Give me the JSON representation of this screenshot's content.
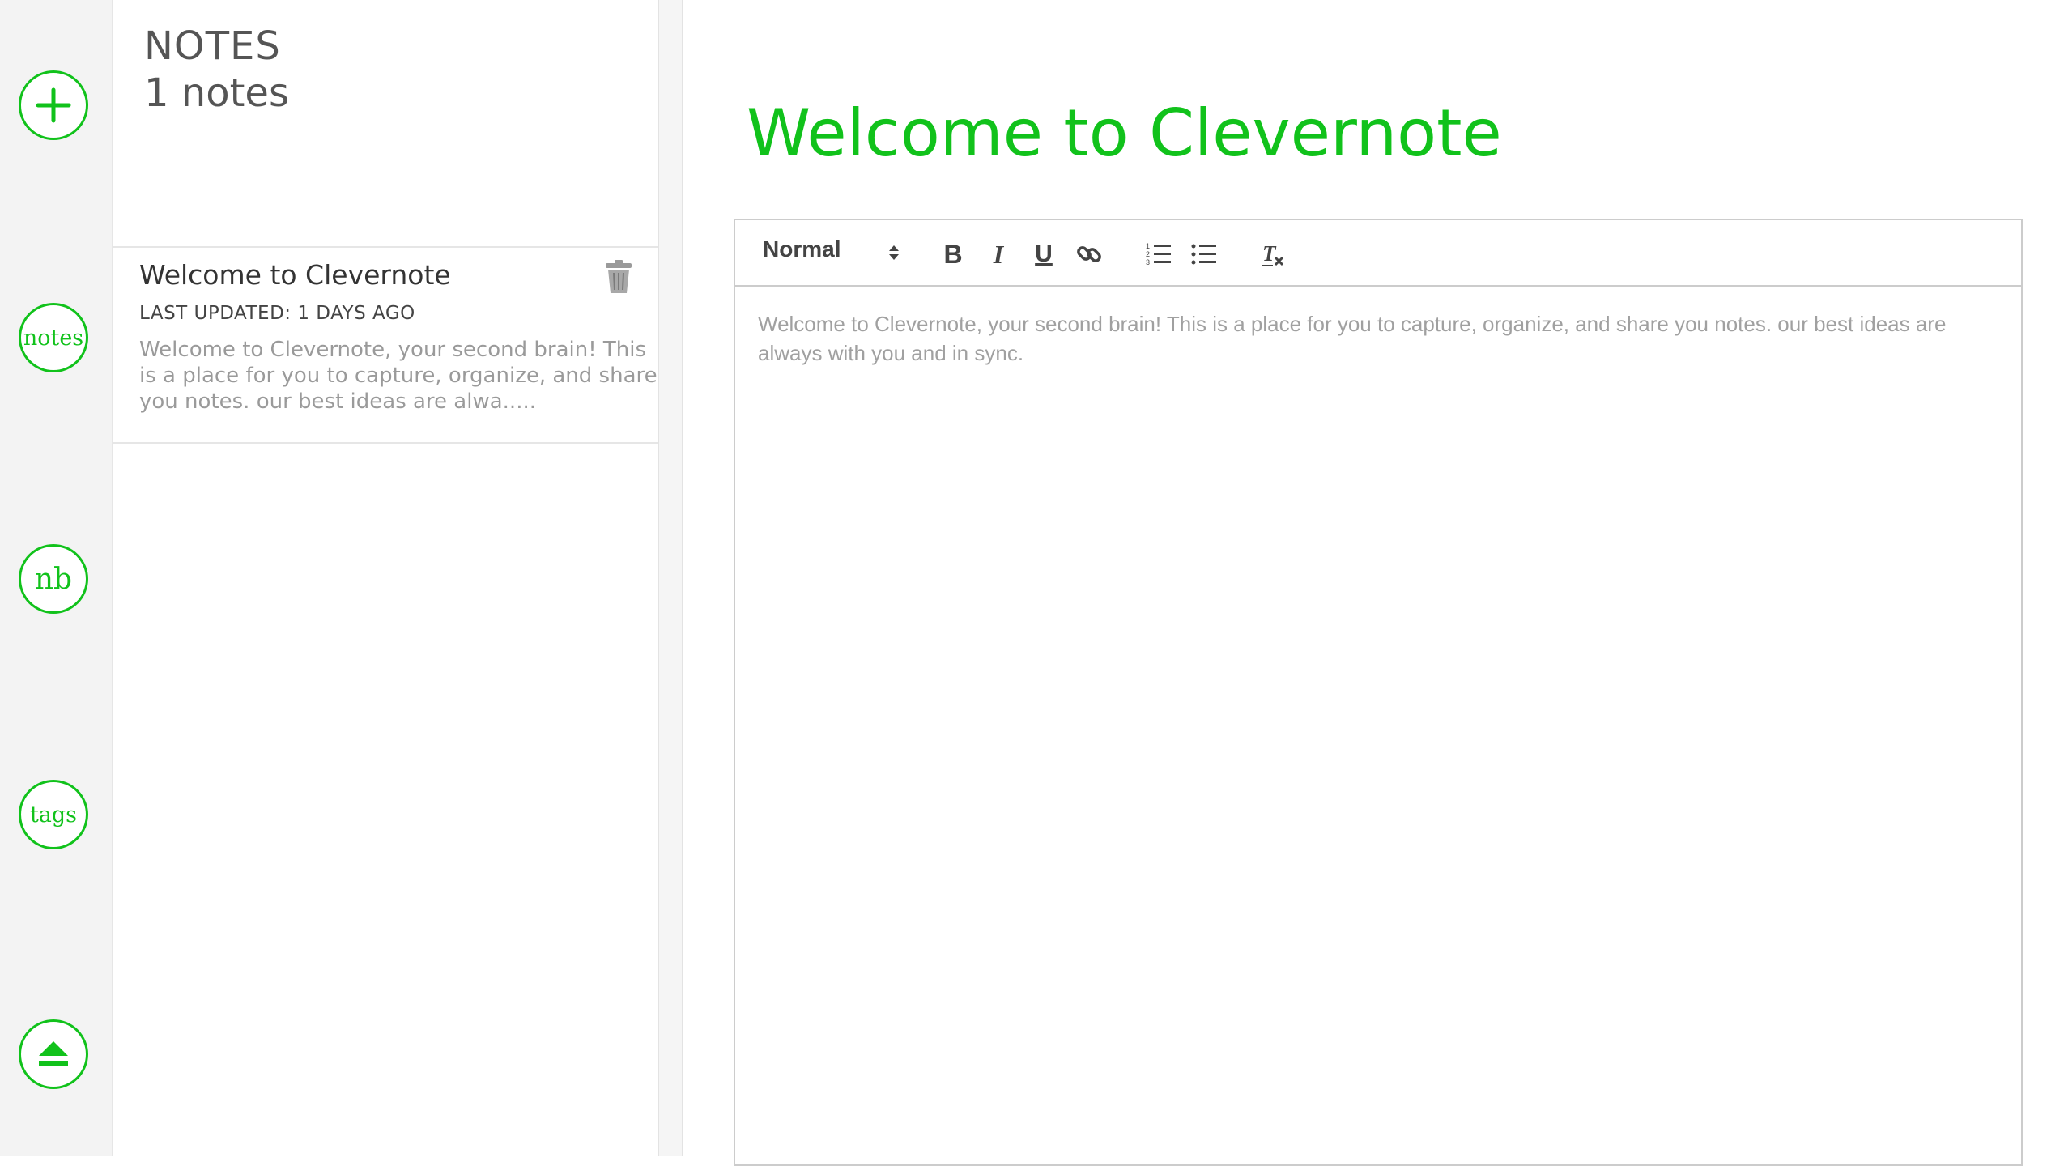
{
  "app": {
    "name": "Clevernote",
    "accent_color": "#11c21b"
  },
  "rail": {
    "items": [
      {
        "name": "new-note",
        "icon": "plus-icon",
        "label": ""
      },
      {
        "name": "notes",
        "icon": "",
        "label": "notes"
      },
      {
        "name": "notebooks",
        "icon": "",
        "label": "nb"
      },
      {
        "name": "tags",
        "icon": "",
        "label": "tags"
      },
      {
        "name": "logout",
        "icon": "eject-icon",
        "label": ""
      }
    ]
  },
  "notes_panel": {
    "heading": "NOTES",
    "count_text": "1 notes",
    "items": [
      {
        "title": "Welcome to Clevernote",
        "last_updated": "LAST UPDATED: 1 DAYS AGO",
        "snippet": "Welcome to Clevernote, your second brain! This is a place for you to capture, organize, and share you notes. our best ideas are alwa.....",
        "trash_icon": "trash-icon"
      }
    ]
  },
  "editor": {
    "title": "Welcome to Clevernote",
    "toolbar": {
      "format_value": "Normal",
      "buttons": [
        {
          "name": "bold",
          "label": "B"
        },
        {
          "name": "italic",
          "label": "I"
        },
        {
          "name": "underline",
          "label": "U"
        },
        {
          "name": "link",
          "icon": "link-icon"
        },
        {
          "name": "ordered-list",
          "icon": "ordered-list-icon"
        },
        {
          "name": "bullet-list",
          "icon": "bullet-list-icon"
        },
        {
          "name": "clear-format",
          "icon": "clear-format-icon"
        }
      ]
    },
    "body": "Welcome to Clevernote, your second brain! This is a place for you to capture, organize, and share you notes. our best ideas are always with you and in sync."
  }
}
